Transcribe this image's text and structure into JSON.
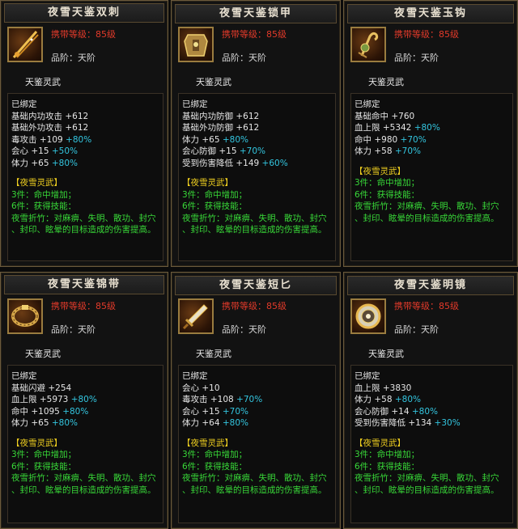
{
  "items": [
    {
      "name": "夜雪天鉴双刺",
      "level": "携带等级：85级",
      "grade": "品阶：天阶",
      "subtitle": "天鉴灵武",
      "icon": "dagger-icon",
      "bound": "已绑定",
      "stats": [
        {
          "text": "基础内功攻击 +612",
          "bonus": ""
        },
        {
          "text": "基础外功攻击 +612",
          "bonus": ""
        },
        {
          "text": "毒攻击 +109",
          "bonus": "+80%"
        },
        {
          "text": "会心 +15",
          "bonus": "+50%"
        },
        {
          "text": "体力 +65",
          "bonus": "+80%"
        }
      ],
      "set_title": "【夜雪灵武】",
      "set_lines": [
        "3件：命中增加；",
        "6件：获得技能：",
        "夜雪折竹：对麻痹、失明、散功、封穴",
        "、封印、眩晕的目标造成的伤害提高。"
      ]
    },
    {
      "name": "夜雪天鉴锁甲",
      "level": "携带等级：85级",
      "grade": "品阶：天阶",
      "subtitle": "天鉴灵武",
      "icon": "armor-icon",
      "bound": "已绑定",
      "stats": [
        {
          "text": "基础内功防御 +612",
          "bonus": ""
        },
        {
          "text": "基础外功防御 +612",
          "bonus": ""
        },
        {
          "text": "体力 +65",
          "bonus": "+80%"
        },
        {
          "text": "会心防御 +15",
          "bonus": "+70%"
        },
        {
          "text": "受到伤害降低 +149",
          "bonus": "+60%"
        }
      ],
      "set_title": "【夜雪灵武】",
      "set_lines": [
        "3件：命中增加；",
        "6件：获得技能：",
        "夜雪折竹：对麻痹、失明、散功、封穴",
        "、封印、眩晕的目标造成的伤害提高。"
      ]
    },
    {
      "name": "夜雪天鉴玉钩",
      "level": "携带等级：85级",
      "grade": "品阶：天阶",
      "subtitle": "天鉴灵武",
      "icon": "hook-icon",
      "bound": "已绑定",
      "stats": [
        {
          "text": "基础命中 +760",
          "bonus": ""
        },
        {
          "text": "血上限 +5342",
          "bonus": "+80%"
        },
        {
          "text": "命中 +980",
          "bonus": "+70%"
        },
        {
          "text": "体力 +58",
          "bonus": "+70%"
        }
      ],
      "set_title": "【夜雪灵武】",
      "set_lines": [
        "3件：命中增加；",
        "6件：获得技能：",
        "夜雪折竹：对麻痹、失明、散功、封穴",
        "、封印、眩晕的目标造成的伤害提高。"
      ]
    },
    {
      "name": "夜雪天鉴锦带",
      "level": "携带等级：85级",
      "grade": "品阶：天阶",
      "subtitle": "天鉴灵武",
      "icon": "belt-icon",
      "bound": "已绑定",
      "stats": [
        {
          "text": "基础闪避 +254",
          "bonus": ""
        },
        {
          "text": "血上限 +5973",
          "bonus": "+80%"
        },
        {
          "text": "命中 +1095",
          "bonus": "+80%"
        },
        {
          "text": "体力 +65",
          "bonus": "+80%"
        }
      ],
      "set_title": "【夜雪灵武】",
      "set_lines": [
        "3件：命中增加；",
        "6件：获得技能：",
        "夜雪折竹：对麻痹、失明、散功、封穴",
        "、封印、眩晕的目标造成的伤害提高。"
      ]
    },
    {
      "name": "夜雪天鉴短匕",
      "level": "携带等级：85级",
      "grade": "品阶：天阶",
      "subtitle": "天鉴灵武",
      "icon": "short-dagger-icon",
      "bound": "已绑定",
      "stats": [
        {
          "text": "会心 +10",
          "bonus": ""
        },
        {
          "text": "毒攻击 +108",
          "bonus": "+70%"
        },
        {
          "text": "会心 +15",
          "bonus": "+70%"
        },
        {
          "text": "体力 +64",
          "bonus": "+80%"
        }
      ],
      "set_title": "【夜雪灵武】",
      "set_lines": [
        "3件：命中增加；",
        "6件：获得技能：",
        "夜雪折竹：对麻痹、失明、散功、封穴",
        "、封印、眩晕的目标造成的伤害提高。"
      ]
    },
    {
      "name": "夜雪天鉴明镜",
      "level": "携带等级：85级",
      "grade": "品阶：天阶",
      "subtitle": "天鉴灵武",
      "icon": "mirror-icon",
      "bound": "已绑定",
      "stats": [
        {
          "text": "血上限 +3830",
          "bonus": ""
        },
        {
          "text": "体力 +58",
          "bonus": "+80%"
        },
        {
          "text": "会心防御 +14",
          "bonus": "+80%"
        },
        {
          "text": "受到伤害降低 +134",
          "bonus": "+30%"
        }
      ],
      "set_title": "【夜雪灵武】",
      "set_lines": [
        "3件：命中增加；",
        "6件：获得技能：",
        "夜雪折竹：对麻痹、失明、散功、封穴",
        "、封印、眩晕的目标造成的伤害提高。"
      ]
    }
  ]
}
